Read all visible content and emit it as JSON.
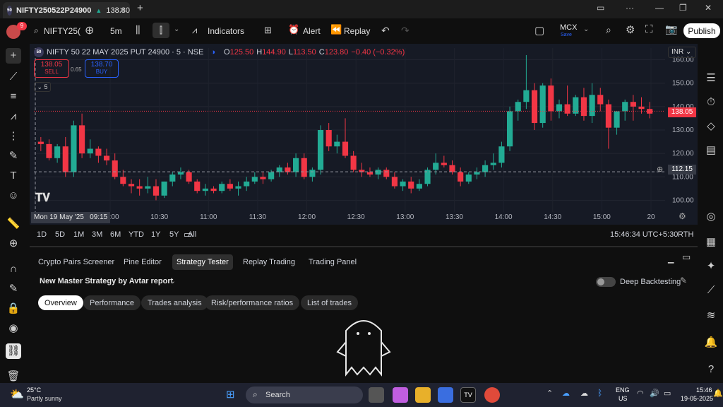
{
  "tab": {
    "title": "NIFTY250522P24900",
    "price": "138.80",
    "logo": "50"
  },
  "toolbar": {
    "notif_count": "9",
    "symbol": "NIFTY25(",
    "interval": "5m",
    "indicators": "Indicators",
    "alert": "Alert",
    "replay": "Replay",
    "exchange": "MCX",
    "save": "Save",
    "publish": "Publish"
  },
  "legend": {
    "logo": "50",
    "symbol": "NIFTY 50 22 MAY 2025 PUT 24900 · 5 · NSE",
    "o_label": "O",
    "o": "125.50",
    "h_label": "H",
    "h": "144.90",
    "l_label": "L",
    "l": "113.50",
    "c_label": "C",
    "c": "123.80",
    "chg": "−0.40 (−0.32%)",
    "sell_price": "138.05",
    "sell_label": "SELL",
    "spread": "0.65",
    "buy_price": "138.70",
    "buy_label": "BUY",
    "indicator_count": "5",
    "currency": "INR",
    "current_price": "138.05",
    "crosshair_price": "112.15",
    "crosshair_time": "Mon 19 May '25   09:15"
  },
  "chart_data": {
    "type": "candlestick",
    "title": "NIFTY 50 22 MAY 2025 PUT 24900 · 5 · NSE",
    "y_ticks": [
      "160.00",
      "150.00",
      "140.00",
      "130.00",
      "120.00",
      "110.00",
      "100.00"
    ],
    "x_ticks": [
      "10:00",
      "10:30",
      "11:00",
      "11:30",
      "12:00",
      "12:30",
      "13:00",
      "13:30",
      "14:00",
      "14:30",
      "15:00",
      "20"
    ],
    "ylim": [
      95,
      165
    ],
    "candles": [
      [
        125,
        127,
        121,
        124
      ],
      [
        124,
        126,
        117,
        118
      ],
      [
        118,
        124,
        116,
        123
      ],
      [
        123,
        127,
        110,
        112
      ],
      [
        112,
        134,
        110,
        132
      ],
      [
        132,
        137,
        118,
        120
      ],
      [
        120,
        126,
        118,
        122
      ],
      [
        122,
        123,
        116,
        119
      ],
      [
        119,
        122,
        115,
        117
      ],
      [
        117,
        120,
        109,
        110
      ],
      [
        110,
        113,
        106,
        107
      ],
      [
        107,
        109,
        103,
        106
      ],
      [
        106,
        109,
        102,
        105
      ],
      [
        105,
        110,
        103,
        106
      ],
      [
        106,
        109,
        100,
        102
      ],
      [
        102,
        108,
        101,
        108
      ],
      [
        108,
        112,
        106,
        111
      ],
      [
        111,
        114,
        109,
        112
      ],
      [
        112,
        113,
        107,
        108
      ],
      [
        108,
        109,
        103,
        104
      ],
      [
        104,
        107,
        102,
        105
      ],
      [
        105,
        106,
        103,
        104
      ],
      [
        104,
        108,
        103,
        107
      ],
      [
        107,
        109,
        104,
        105
      ],
      [
        105,
        108,
        102,
        106
      ],
      [
        106,
        110,
        104,
        108
      ],
      [
        108,
        112,
        107,
        110
      ],
      [
        110,
        112,
        107,
        109
      ],
      [
        109,
        113,
        108,
        112
      ],
      [
        112,
        115,
        110,
        114
      ],
      [
        114,
        116,
        111,
        112
      ],
      [
        112,
        120,
        110,
        118
      ],
      [
        118,
        120,
        109,
        110
      ],
      [
        110,
        114,
        108,
        113
      ],
      [
        113,
        132,
        111,
        130
      ],
      [
        130,
        133,
        121,
        123
      ],
      [
        123,
        128,
        120,
        125
      ],
      [
        125,
        135,
        118,
        119
      ],
      [
        119,
        121,
        112,
        113
      ],
      [
        113,
        116,
        110,
        112
      ],
      [
        112,
        114,
        110,
        111
      ],
      [
        111,
        114,
        109,
        113
      ],
      [
        113,
        114,
        109,
        110
      ],
      [
        110,
        112,
        105,
        106
      ],
      [
        106,
        109,
        104,
        108
      ],
      [
        108,
        110,
        103,
        105
      ],
      [
        105,
        109,
        104,
        107
      ],
      [
        107,
        114,
        106,
        113
      ],
      [
        113,
        120,
        111,
        116
      ],
      [
        116,
        119,
        114,
        115
      ],
      [
        115,
        117,
        111,
        112
      ],
      [
        112,
        114,
        106,
        108
      ],
      [
        108,
        112,
        107,
        111
      ],
      [
        111,
        114,
        109,
        112
      ],
      [
        112,
        117,
        110,
        115
      ],
      [
        115,
        120,
        113,
        116
      ],
      [
        116,
        125,
        114,
        123
      ],
      [
        123,
        140,
        121,
        138
      ],
      [
        138,
        143,
        134,
        142
      ],
      [
        142,
        162,
        139,
        147
      ],
      [
        147,
        150,
        130,
        133
      ],
      [
        133,
        150,
        131,
        149
      ],
      [
        149,
        152,
        134,
        138
      ],
      [
        138,
        143,
        135,
        141
      ],
      [
        141,
        149,
        136,
        137
      ],
      [
        137,
        145,
        136,
        144
      ],
      [
        144,
        148,
        134,
        136
      ],
      [
        136,
        150,
        133,
        145
      ],
      [
        145,
        148,
        138,
        141
      ],
      [
        141,
        143,
        122,
        131
      ],
      [
        131,
        137,
        128,
        138
      ],
      [
        138,
        143,
        134,
        142
      ],
      [
        142,
        145,
        134,
        140
      ],
      [
        140,
        144,
        137,
        139
      ],
      [
        139,
        142,
        135,
        137
      ]
    ],
    "up_color": "#22ab94",
    "down_color": "#f23645"
  },
  "ranges": [
    "1D",
    "5D",
    "1M",
    "3M",
    "6M",
    "YTD",
    "1Y",
    "5Y",
    "All"
  ],
  "clock": "15:46:34 UTC+5:30",
  "session": "RTH",
  "panel": {
    "tabs": [
      "Crypto Pairs Screener",
      "Pine Editor",
      "Strategy Tester",
      "Replay Trading",
      "Trading Panel"
    ],
    "strategy": "New Master Strategy by Avtar report",
    "deep": "Deep Backtesting",
    "subtabs": [
      "Overview",
      "Performance",
      "Trades analysis",
      "Risk/performance ratios",
      "List of trades"
    ]
  },
  "taskbar": {
    "temp": "25°C",
    "weather": "Partly sunny",
    "search": "Search",
    "lang": "ENG",
    "region": "US",
    "time": "15:46",
    "date": "19-05-2025"
  }
}
